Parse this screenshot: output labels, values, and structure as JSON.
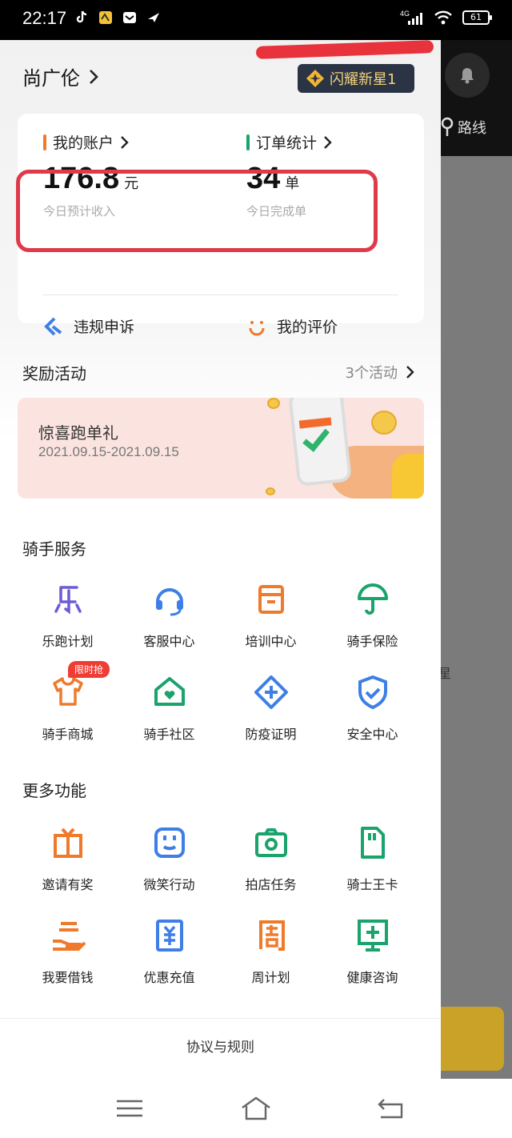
{
  "status_bar": {
    "time": "22:17",
    "network": "4G",
    "battery": "61"
  },
  "background": {
    "route_label": "路线",
    "partial_text": "星"
  },
  "profile": {
    "name": "尚广伦",
    "level_badge": "闪耀新星1"
  },
  "stats": {
    "account": {
      "label": "我的账户",
      "value": "176.8",
      "unit": "元",
      "sub": "今日预计收入"
    },
    "orders": {
      "label": "订单统计",
      "value": "34",
      "unit": "单",
      "sub": "今日完成单"
    }
  },
  "quick_links": {
    "appeal": "违规申诉",
    "reviews": "我的评价"
  },
  "rewards": {
    "title": "奖励活动",
    "count_link": "3个活动",
    "banner_title": "惊喜跑单礼",
    "banner_date": "2021.09.15-2021.09.15"
  },
  "rider_services": {
    "title": "骑手服务",
    "items": [
      {
        "label": "乐跑计划",
        "icon": "le-icon"
      },
      {
        "label": "客服中心",
        "icon": "headset-icon"
      },
      {
        "label": "培训中心",
        "icon": "training-box-icon"
      },
      {
        "label": "骑手保险",
        "icon": "umbrella-icon"
      },
      {
        "label": "骑手商城",
        "icon": "tshirt-icon",
        "tag": "限时抢"
      },
      {
        "label": "骑手社区",
        "icon": "house-heart-icon"
      },
      {
        "label": "防疫证明",
        "icon": "medical-plus-icon"
      },
      {
        "label": "安全中心",
        "icon": "shield-icon"
      }
    ]
  },
  "more_functions": {
    "title": "更多功能",
    "items": [
      {
        "label": "邀请有奖",
        "icon": "gift-icon"
      },
      {
        "label": "微笑行动",
        "icon": "smile-face-icon"
      },
      {
        "label": "拍店任务",
        "icon": "camera-icon"
      },
      {
        "label": "骑士王卡",
        "icon": "sim-card-icon"
      },
      {
        "label": "我要借钱",
        "icon": "hand-money-icon"
      },
      {
        "label": "优惠充值",
        "icon": "recharge-icon"
      },
      {
        "label": "周计划",
        "icon": "week-plan-icon"
      },
      {
        "label": "健康咨询",
        "icon": "health-monitor-icon"
      }
    ]
  },
  "footer": {
    "rules": "协议与规则"
  },
  "colors": {
    "orange": "#f07a2b",
    "blue": "#3d7fe6",
    "green": "#1aa36b",
    "purple": "#6b5bd6",
    "red": "#ef3d35"
  }
}
